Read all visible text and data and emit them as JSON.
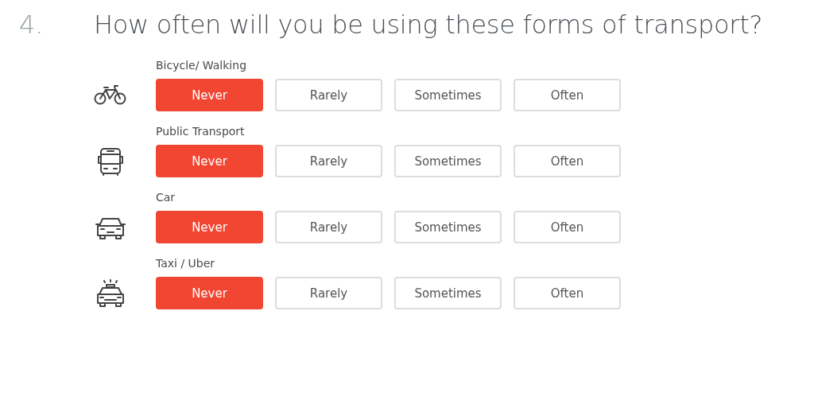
{
  "question": {
    "number": "4.",
    "title": "How often will you be using these forms of transport?"
  },
  "rows": [
    {
      "kind": "bicycle",
      "label": "Bicycle/ Walking",
      "options": [
        {
          "label": "Never",
          "selected": true
        },
        {
          "label": "Rarely",
          "selected": false
        },
        {
          "label": "Sometimes",
          "selected": false
        },
        {
          "label": "Often",
          "selected": false
        }
      ]
    },
    {
      "kind": "bus",
      "label": "Public Transport",
      "options": [
        {
          "label": "Never",
          "selected": true
        },
        {
          "label": "Rarely",
          "selected": false
        },
        {
          "label": "Sometimes",
          "selected": false
        },
        {
          "label": "Often",
          "selected": false
        }
      ]
    },
    {
      "kind": "car",
      "label": "Car",
      "options": [
        {
          "label": "Never",
          "selected": true
        },
        {
          "label": "Rarely",
          "selected": false
        },
        {
          "label": "Sometimes",
          "selected": false
        },
        {
          "label": "Often",
          "selected": false
        }
      ]
    },
    {
      "kind": "taxi",
      "label": "Taxi / Uber",
      "options": [
        {
          "label": "Never",
          "selected": true
        },
        {
          "label": "Rarely",
          "selected": false
        },
        {
          "label": "Sometimes",
          "selected": false
        },
        {
          "label": "Often",
          "selected": false
        }
      ]
    }
  ]
}
